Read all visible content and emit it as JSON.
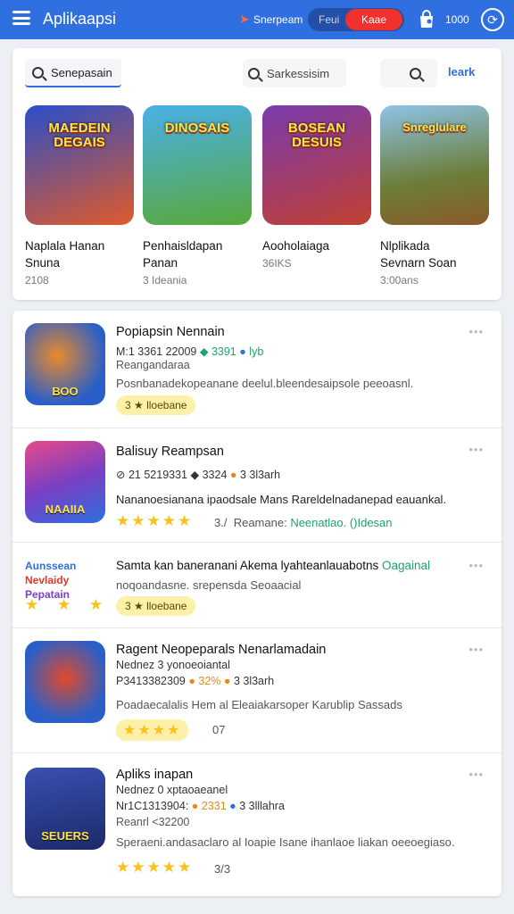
{
  "topbar": {
    "title": "Aplikaapsi",
    "link": "Snerpeam",
    "toggle_off": "Feui",
    "toggle_on": "Kaae",
    "coins": "1000"
  },
  "search": {
    "tab1": "Senepasain",
    "tab2": "Sarkessisim",
    "learn": "leark"
  },
  "featured": [
    {
      "art": "MAEDEIN DEGAIS",
      "name1": "Naplala Hanan",
      "name2": "Snuna",
      "meta": "2108",
      "bg": "#3a6fd8"
    },
    {
      "art": "DINOSAIS",
      "name1": "Penhaisldapan",
      "name2": "Panan",
      "meta": "3 Ideania",
      "bg": "#49a24a"
    },
    {
      "art": "BOSEAN DESUIS",
      "name1": "Aooholaiaga",
      "name2": "",
      "meta": "36IKS",
      "bg": "#6b3fa8"
    },
    {
      "art": "Snreglulare",
      "name1": "Nlplikada",
      "name2": "Sevnarn Soan",
      "meta": "3:00ans",
      "bg": "#6a8c3a"
    }
  ],
  "list": [
    {
      "title": "Popiapsin Nennain",
      "sub_a": "M:1 3361 22009",
      "sub_b": "3391",
      "sub_c": "lyb",
      "sub_d": "Reangandaraa",
      "desc": "Posnbanadekopeanane deelul.bleendesaipsole peeoasnl.",
      "pill": "3 ★ lloebane",
      "icon_label": "ВОО",
      "icon_bg": "#2b5fc7"
    },
    {
      "title": "Balisuy Reampsan",
      "sub_a": "21 5219331",
      "sub_b": "3324",
      "sub_c": "3 3l3arh",
      "desc": "Nananoesianana ipaodsale Mans Rareldelnadanepad eauankal.",
      "stars": "★★★★★",
      "after_a": "3./",
      "after_b": "Reamane:",
      "after_c": "Neenatlao.",
      "after_d": "()Idesan",
      "icon_label": "NAAIIA",
      "icon_bg": "#8a3fc2"
    },
    {
      "title": "Samta kan baneranani Akema lyahteanlauabotns",
      "title_tag": "Oagainal",
      "sub": "noqoandasne. srepensda Seoaacial",
      "pill": "3 ★ lloebane",
      "logo1": "Aunssean",
      "logo2": "Nevlaidy",
      "logo3": "Pepatain",
      "stars": "★ ★ ★ ★"
    },
    {
      "title": "Ragent Neopeparals Nenarlamadain",
      "sub_tag": "Nednez 3 yonoeoiantal",
      "sub_a": "P3413382309",
      "sub_b": "32%",
      "sub_c": "3 3l3arh",
      "desc": "Poadaecalalis Hem al Eleaiakarsoper Karublip Sassads",
      "stars": "★★★★",
      "after_a": "07",
      "icon_bg": "#2b5fc7"
    },
    {
      "title": "Apliks inapan",
      "sub_tag": "Nednez 0 xptaoaeanel",
      "sub_a": "Nr1C1313904:",
      "sub_b": "2331",
      "sub_c": "3 3lllahra",
      "sub_d": "Reanrl <32200",
      "desc": "Speraeni.andasaclaro al Ioapie Isane ihanlaoe liakan oeeoegiaso.",
      "stars": "★★★★★",
      "after_a": "3/3",
      "icon_label": "SEUERS",
      "icon_bg": "#243a8e"
    }
  ]
}
